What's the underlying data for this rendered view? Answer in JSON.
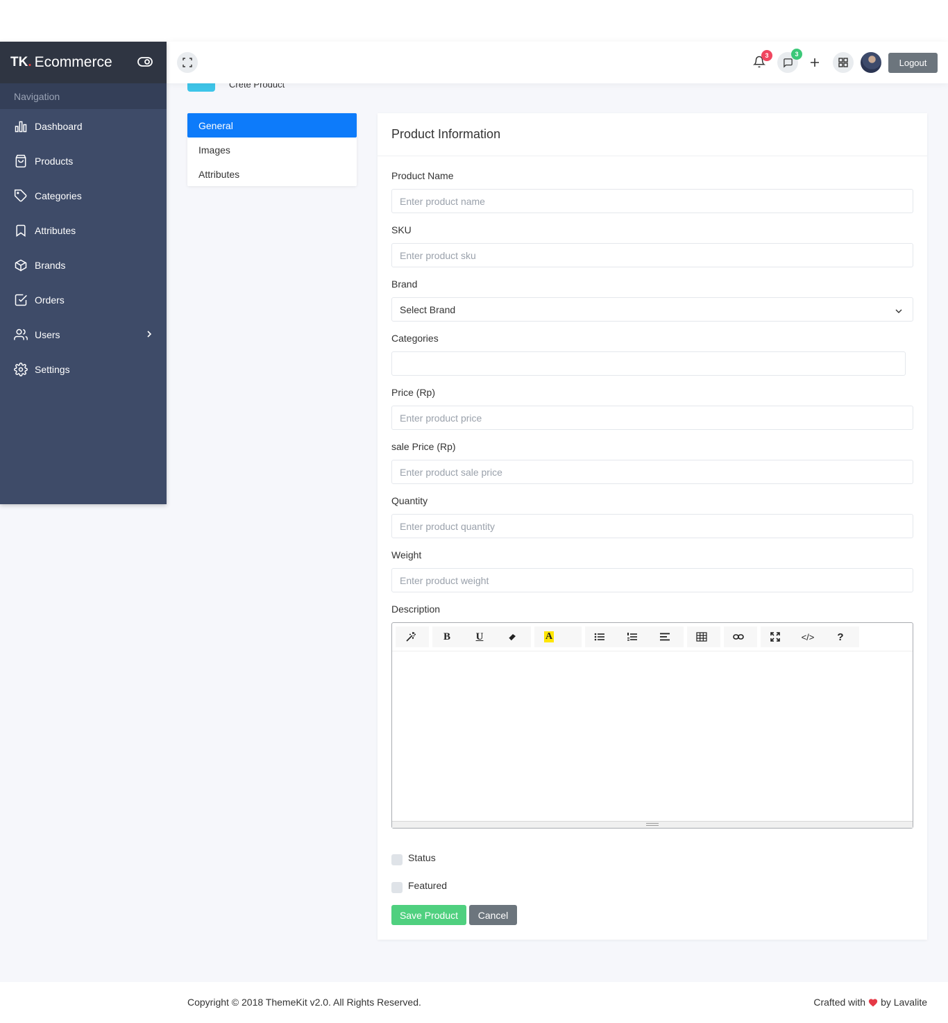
{
  "sidebar": {
    "brand_tk": "TK",
    "brand_dot": ".",
    "brand_name": "Ecommerce",
    "nav_heading": "Navigation",
    "items": [
      {
        "label": "Dashboard",
        "icon": "bar-chart-icon"
      },
      {
        "label": "Products",
        "icon": "shopping-bag-icon"
      },
      {
        "label": "Categories",
        "icon": "tag-icon"
      },
      {
        "label": "Attributes",
        "icon": "bookmark-icon"
      },
      {
        "label": "Brands",
        "icon": "box-icon"
      },
      {
        "label": "Orders",
        "icon": "check-square-icon"
      },
      {
        "label": "Users",
        "icon": "users-icon"
      },
      {
        "label": "Settings",
        "icon": "gear-icon"
      }
    ]
  },
  "header": {
    "notifications_count": "3",
    "messages_count": "3",
    "logout_label": "Logout"
  },
  "page": {
    "title": "Crete Product"
  },
  "tabs": [
    {
      "label": "General",
      "active": true
    },
    {
      "label": "Images",
      "active": false
    },
    {
      "label": "Attributes",
      "active": false
    }
  ],
  "form": {
    "card_title": "Product Information",
    "name_label": "Product Name",
    "name_placeholder": "Enter product name",
    "sku_label": "SKU",
    "sku_placeholder": "Enter product sku",
    "brand_label": "Brand",
    "brand_value": "Select Brand",
    "categories_label": "Categories",
    "price_label": "Price (Rp)",
    "price_placeholder": "Enter product price",
    "sale_label": "sale Price (Rp)",
    "sale_placeholder": "Enter product sale price",
    "qty_label": "Quantity",
    "qty_placeholder": "Enter product quantity",
    "weight_label": "Weight",
    "weight_placeholder": "Enter product weight",
    "description_label": "Description",
    "status_label": "Status",
    "featured_label": "Featured",
    "save_label": "Save Product",
    "cancel_label": "Cancel"
  },
  "editor": {
    "bold": "B",
    "underline": "U",
    "highlight": "A",
    "code": "</>",
    "help": "?"
  },
  "colors": {
    "accent": "#0d7bfa",
    "sidebar": "#3e4b68",
    "save": "#4fd07f",
    "badge_red": "#f0465f",
    "badge_green": "#3cc878"
  },
  "footer": {
    "copyright": "Copyright © 2018 ThemeKit v2.0. All Rights Reserved.",
    "crafted_prefix": "Crafted with",
    "crafted_suffix": "by Lavalite"
  }
}
